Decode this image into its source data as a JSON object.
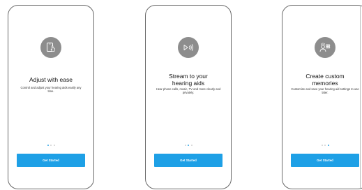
{
  "screens": [
    {
      "icon": "phone-touch-icon",
      "title": "Adjust with ease",
      "description": "Control and adjust your hearing aids easily any time.",
      "button_label": "Get Started",
      "active_dot": 0
    },
    {
      "icon": "stream-audio-icon",
      "title": "Stream to your hearing aids",
      "description": "Hear phone calls, music, TV and more clearly and privately.",
      "button_label": "Get Started",
      "active_dot": 1
    },
    {
      "icon": "custom-memories-icon",
      "title": "Create custom memories",
      "description": "Customize and save your hearing aid settings to use later.",
      "button_label": "Get Started",
      "active_dot": 2
    }
  ],
  "page_indicator": {
    "count": 3
  },
  "colors": {
    "accent": "#1ea0e6",
    "icon_circle": "#8d8d8d",
    "dot_inactive": "#d0d0d0",
    "dot_active": "#2aa3e6"
  }
}
